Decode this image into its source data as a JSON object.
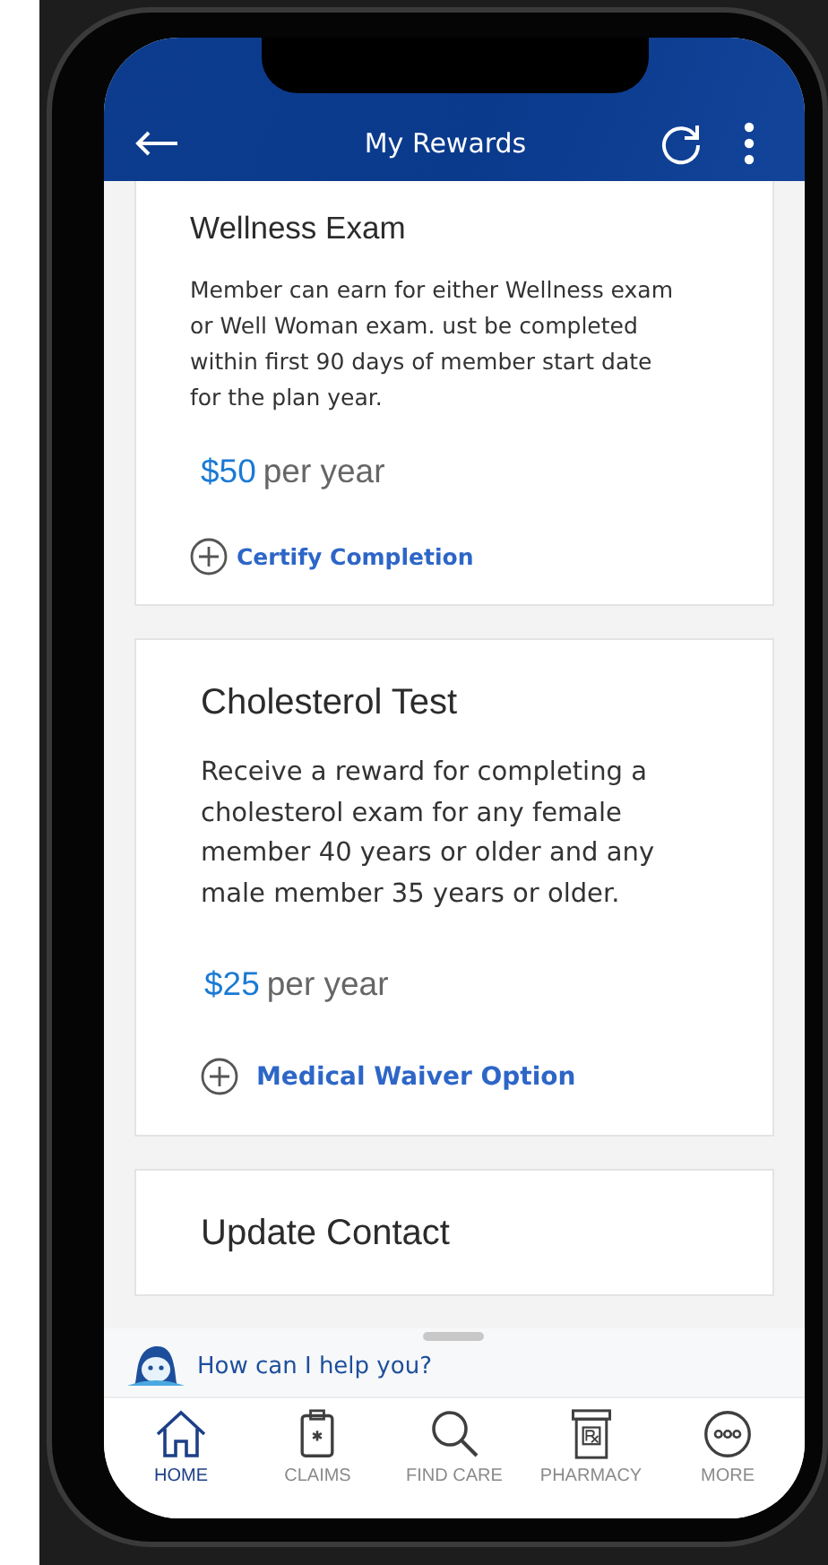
{
  "header": {
    "title": "My Rewards"
  },
  "rewards": [
    {
      "title": "Wellness Exam",
      "description": "Member can earn for either Wellness exam or Well Woman exam. ust be completed within first 90 days of member start date for the plan year.",
      "amount": "$50",
      "period": "per year",
      "action": "Certify Completion"
    },
    {
      "title": "Cholesterol Test",
      "description": "Receive a reward for completing a cholesterol exam for any female member 40 years or older and any male member 35 years or older.",
      "amount": "$25",
      "period": "per year",
      "action": "Medical Waiver Option"
    },
    {
      "title": "Update Contact"
    }
  ],
  "chat": {
    "prompt": "How can I help you?"
  },
  "nav": [
    {
      "kind": "home",
      "label": "HOME",
      "selected": true
    },
    {
      "kind": "claims",
      "label": "CLAIMS",
      "selected": false
    },
    {
      "kind": "search",
      "label": "FIND CARE",
      "selected": false
    },
    {
      "kind": "pharmacy",
      "label": "PHARMACY",
      "selected": false
    },
    {
      "kind": "more",
      "label": "MORE",
      "selected": false
    }
  ]
}
